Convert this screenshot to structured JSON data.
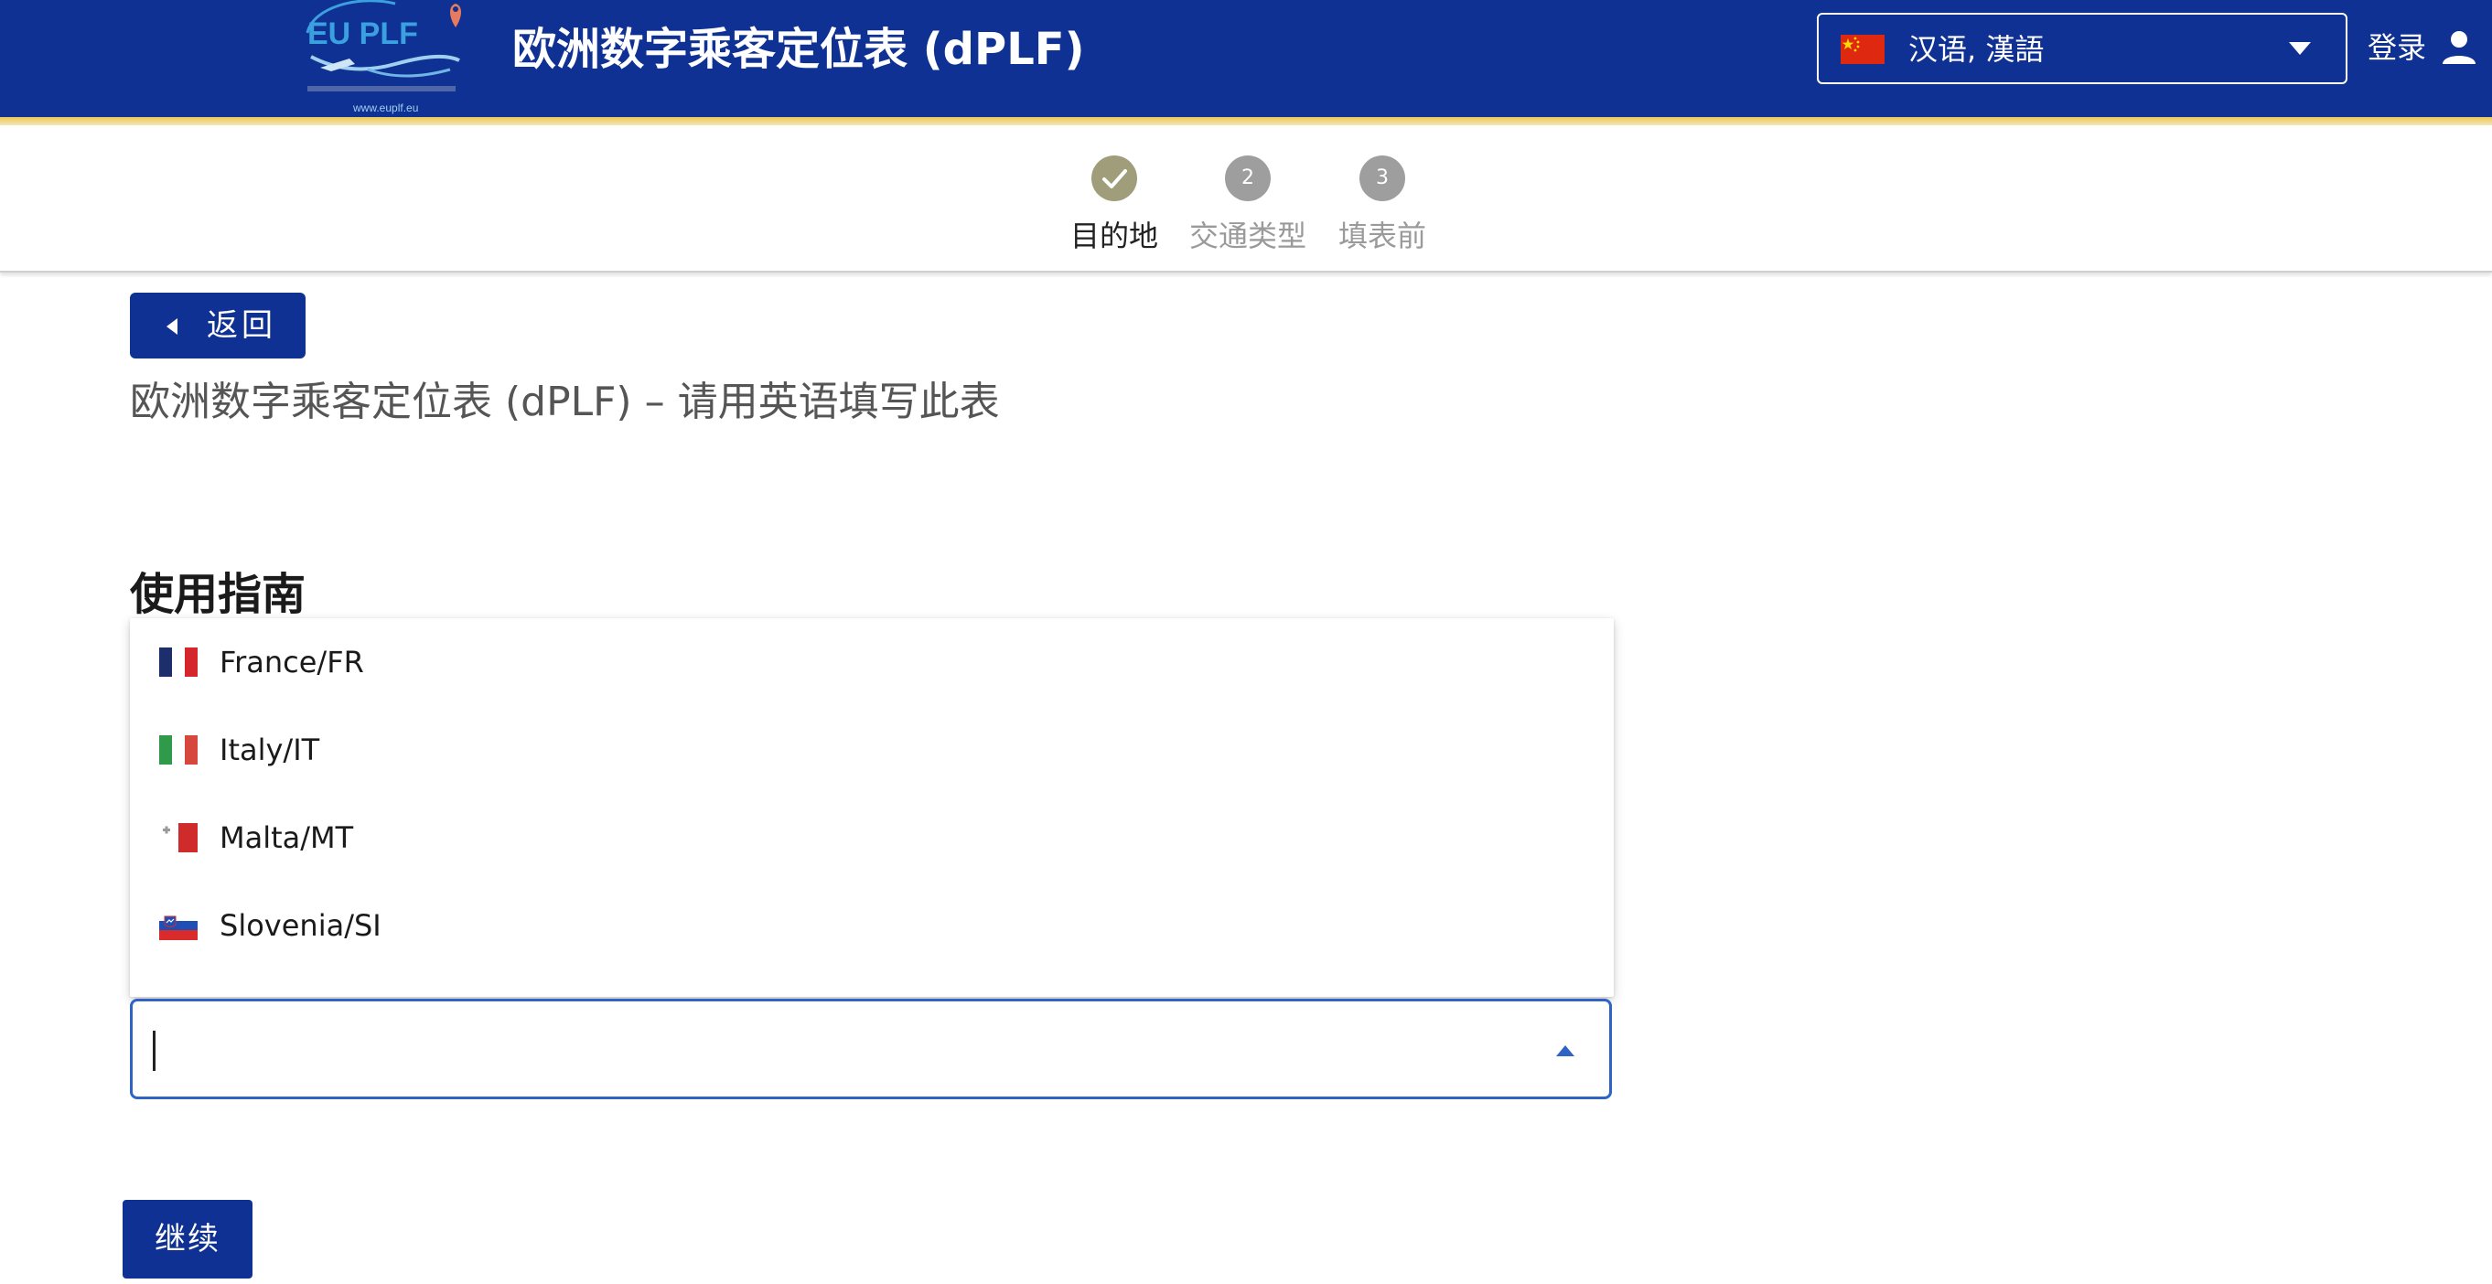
{
  "header": {
    "logo_text": "EU PLF",
    "logo_url_text": "www.euplf.eu",
    "title": "欧洲数字乘客定位表 (dPLF)",
    "language": {
      "selected": "汉语, 漢語",
      "flag_icon": "china-flag-icon"
    },
    "login_label": "登录",
    "user_icon": "user-icon"
  },
  "stepper": {
    "steps": [
      {
        "number": "1",
        "label": "目的地",
        "status": "completed",
        "icon": "checkmark-icon"
      },
      {
        "number": "2",
        "label": "交通类型",
        "status": "pending"
      },
      {
        "number": "3",
        "label": "填表前",
        "status": "pending"
      }
    ]
  },
  "page": {
    "back_label": "返回",
    "subtitle": "欧洲数字乘客定位表 (dPLF) – 请用英语填写此表",
    "section_heading": "使用指南"
  },
  "country_select": {
    "value": "",
    "expanded": true,
    "options": [
      {
        "label": "France/FR",
        "flag_icon": "france-flag-icon"
      },
      {
        "label": "Italy/IT",
        "flag_icon": "italy-flag-icon"
      },
      {
        "label": "Malta/MT",
        "flag_icon": "malta-flag-icon"
      },
      {
        "label": "Slovenia/SI",
        "flag_icon": "slovenia-flag-icon"
      }
    ]
  },
  "continue_label": "继续",
  "colors": {
    "brand_blue": "#0f3193",
    "accent_gold": "#e9c85a",
    "step_done": "#a09e7a",
    "step_pending": "#9e9e9e",
    "focus_blue": "#2f63c6"
  }
}
